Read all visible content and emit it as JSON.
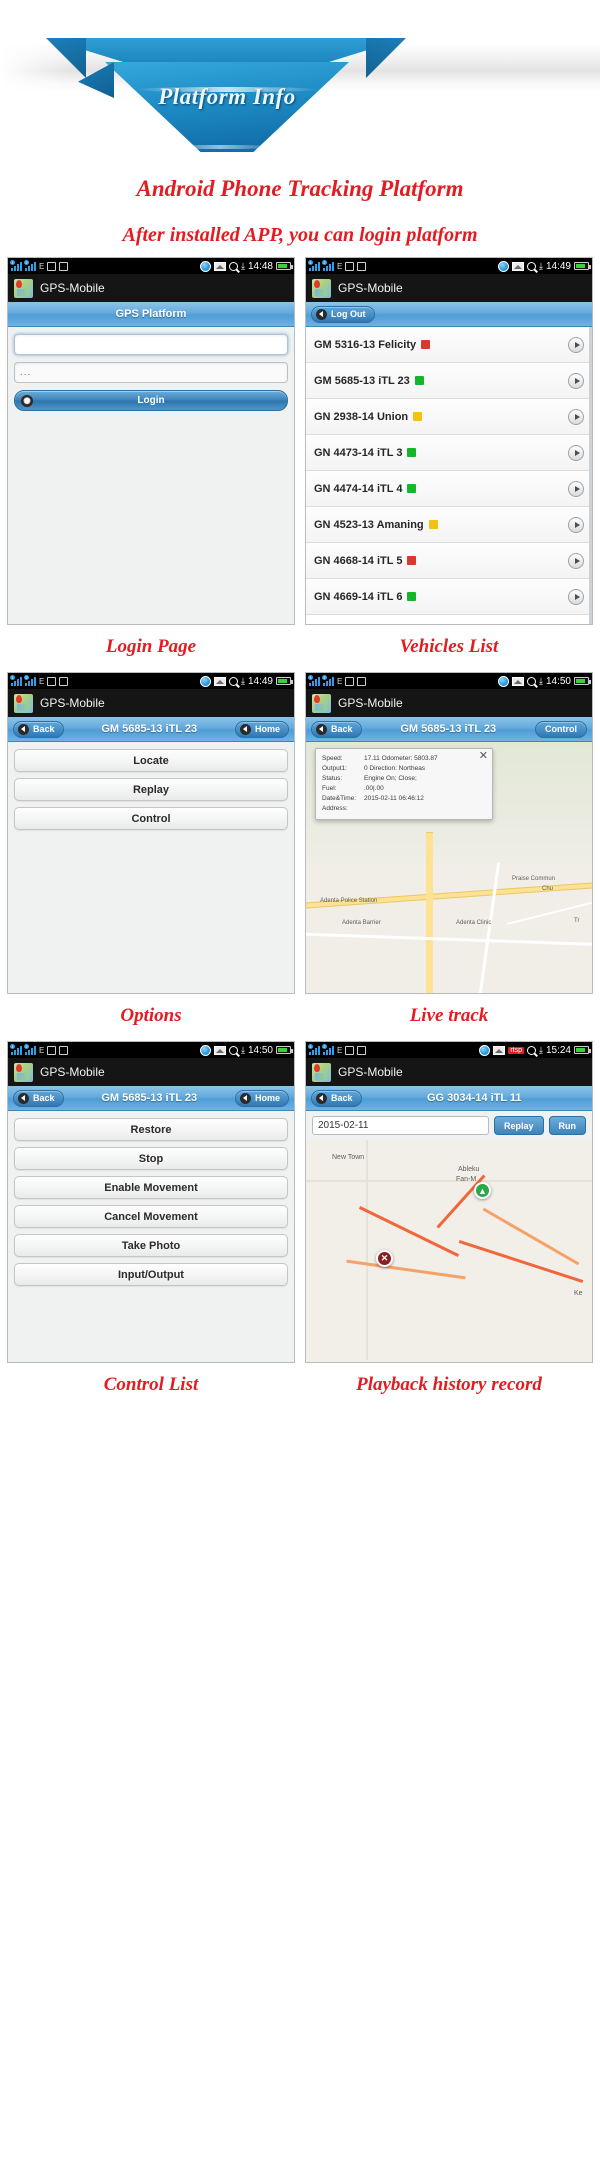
{
  "banner": {
    "label": "Platform Info"
  },
  "headings": {
    "main": "Android Phone Tracking Platform",
    "sub": "After installed APP, you can login platform"
  },
  "captions": {
    "login": "Login Page",
    "vehicles": "Vehicles List",
    "options": "Options",
    "livetrack": "Live track",
    "control": "Control List",
    "playback": "Playback history record"
  },
  "app": {
    "name": "GPS-Mobile",
    "logo_icon": "map-pin-icon"
  },
  "statusbar": {
    "signal_icon": "signal-bars-icon",
    "edge_icon": "edge-network-icon",
    "vibrate_icon": "vibrate-icon",
    "alarm_icon": "alarm-clock-icon",
    "chat_icon": "blue-chat-icon",
    "gallery_icon": "gallery-icon",
    "search_icon": "search-icon",
    "download_icon": "download-icon",
    "battery_icon": "battery-icon",
    "times": {
      "login": "14:48",
      "vehicles": "14:49",
      "options": "14:49",
      "livetrack": "14:50",
      "control": "14:50",
      "playback": "15:24"
    }
  },
  "screens": {
    "login": {
      "nav_title": "GPS Platform",
      "username_value": "",
      "username_placeholder": "",
      "password_value": "...",
      "login_button": "Login",
      "login_icon": "gear-icon"
    },
    "vehicles": {
      "logout_button": "Log Out",
      "back_icon": "back-arrow-icon",
      "rows": [
        {
          "name": "GM 5316-13 Felicity",
          "status_color": "#d63a2e"
        },
        {
          "name": "GM 5685-13 iTL 23",
          "status_color": "#17b52a"
        },
        {
          "name": "GN 2938-14 Union",
          "status_color": "#f3c018"
        },
        {
          "name": "GN 4473-14 iTL 3",
          "status_color": "#17b52a"
        },
        {
          "name": "GN 4474-14 iTL 4",
          "status_color": "#17b52a"
        },
        {
          "name": "GN 4523-13 Amaning",
          "status_color": "#f3c018"
        },
        {
          "name": "GN 4668-14 iTL 5",
          "status_color": "#d63a2e"
        },
        {
          "name": "GN 4669-14 iTL 6",
          "status_color": "#17b52a"
        }
      ],
      "chevron_icon": "chevron-right-icon"
    },
    "options": {
      "back_button": "Back",
      "title": "GM 5685-13 iTL 23",
      "home_button": "Home",
      "buttons": [
        "Locate",
        "Replay",
        "Control"
      ]
    },
    "livetrack": {
      "back_button": "Back",
      "title": "GM 5685-13 iTL 23",
      "control_button": "Control",
      "close_icon": "close-icon",
      "info": [
        {
          "key": "Speed:",
          "value": "17.11 Odometer: 5803.87"
        },
        {
          "key": "Output1:",
          "value": "0      Direction: Northeas"
        },
        {
          "key": "Status:",
          "value": "Engine On; Close;"
        },
        {
          "key": "Fuel:",
          "value": ".00|.00"
        },
        {
          "key": "Date&Time:",
          "value": "2015-02-11 06:46:12"
        },
        {
          "key": "Address:",
          "value": ""
        }
      ],
      "map_labels": [
        "Adenta Police Station",
        "Adenta Barrier",
        "Adenta Clinic",
        "Praise Commun",
        "Chu",
        "Tr"
      ]
    },
    "control": {
      "back_button": "Back",
      "title": "GM 5685-13 iTL 23",
      "home_button": "Home",
      "buttons": [
        "Restore",
        "Stop",
        "Enable Movement",
        "Cancel Movement",
        "Take Photo",
        "Input/Output"
      ]
    },
    "playback": {
      "back_button": "Back",
      "title": "GG 3034-14 iTL 11",
      "date_value": "2015-02-11",
      "replay_button": "Replay",
      "run_button": "Run",
      "map_labels": [
        "New Town",
        "Ableku",
        "Fan-M",
        "Ke"
      ],
      "start_marker": "start-marker-icon",
      "end_marker": "end-marker-icon"
    }
  },
  "colors": {
    "accent_red": "#e31c22",
    "nav_blue": "#4e9ed6",
    "banner_blue": "#1e8cc6"
  }
}
